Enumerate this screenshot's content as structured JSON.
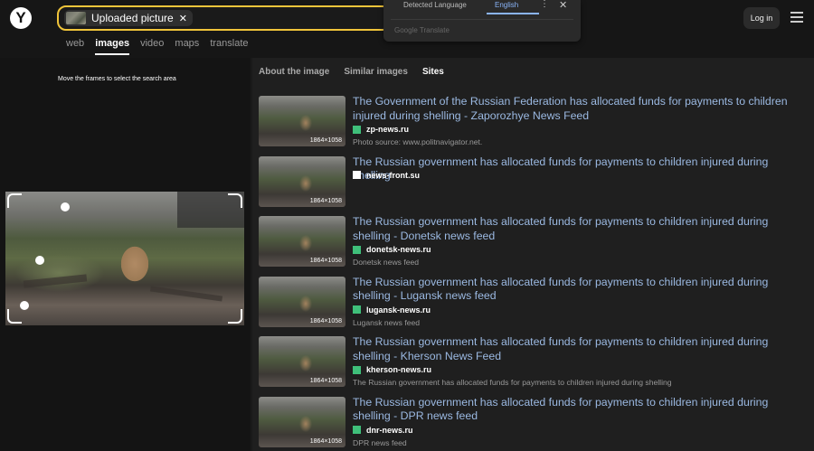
{
  "logo": {
    "letter": "Y"
  },
  "search": {
    "chip_label": "Uploaded picture",
    "chip_close": "✕"
  },
  "nav_tabs": [
    "web",
    "images",
    "video",
    "maps",
    "translate"
  ],
  "translate_popup": {
    "detected_label": "Detected Language",
    "target_language": "English",
    "menu_icon": "⋮",
    "close_icon": "✕",
    "brand": "Google Translate"
  },
  "header": {
    "login_label": "Log in"
  },
  "left_panel": {
    "hint": "Move the frames to select the search area"
  },
  "right_panel": {
    "tabs": [
      "About the image",
      "Similar images",
      "Sites"
    ],
    "active_tab": "Sites",
    "results": [
      {
        "title": "The Government of the Russian Federation has allocated funds for payments to children injured during shelling - Zaporozhye News Feed",
        "dimensions": "1864×1058",
        "site": "zp-news.ru",
        "description": "Photo source: www.politnavigator.net."
      },
      {
        "title": "The Russian government has allocated funds for payments to children injured during shelling",
        "dimensions": "1864×1058",
        "site": "news-front.su",
        "description": ""
      },
      {
        "title": "The Russian government has allocated funds for payments to children injured during shelling - Donetsk news feed",
        "dimensions": "1864×1058",
        "site": "donetsk-news.ru",
        "description": "Donetsk news feed"
      },
      {
        "title": "The Russian government has allocated funds for payments to children injured during shelling - Lugansk news feed",
        "dimensions": "1864×1058",
        "site": "lugansk-news.ru",
        "description": "Lugansk news feed"
      },
      {
        "title": "The Russian government has allocated funds for payments to children injured during shelling - Kherson News Feed",
        "dimensions": "1864×1058",
        "site": "kherson-news.ru",
        "description": "The Russian government has allocated funds for payments to children injured during shelling"
      },
      {
        "title": "The Russian government has allocated funds for payments to children injured during shelling - DPR news feed",
        "dimensions": "1864×1058",
        "site": "dnr-news.ru",
        "description": "DPR news feed"
      }
    ]
  },
  "colors": {
    "accent_search_border": "#f0c43a",
    "link": "#9bb9e2",
    "favicon_green": "#3fbf7a",
    "translate_accent": "#8ab4f8"
  }
}
